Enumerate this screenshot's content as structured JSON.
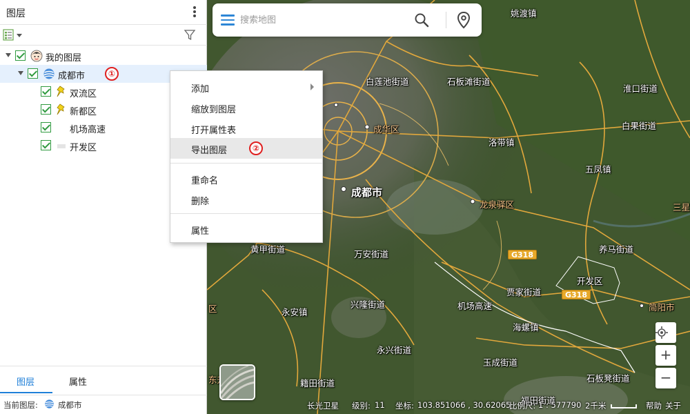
{
  "panel": {
    "title": "图层",
    "tree": {
      "root": {
        "label": "我的图层",
        "checked": true
      },
      "group": {
        "label": "成都市",
        "checked": true,
        "badge": "①"
      },
      "layers": [
        {
          "label": "双流区",
          "checked": true,
          "icon": "pushpin-icon"
        },
        {
          "label": "新都区",
          "checked": true,
          "icon": "pushpin-icon"
        },
        {
          "label": "机场高速",
          "checked": true,
          "icon": "none"
        },
        {
          "label": "开发区",
          "checked": true,
          "icon": "polygon-icon"
        }
      ]
    },
    "tabs": [
      {
        "label": "图层",
        "active": true
      },
      {
        "label": "属性",
        "active": false
      }
    ],
    "status": {
      "label": "当前图层:",
      "layer": "成都市"
    }
  },
  "context_menu": {
    "items": [
      {
        "label": "添加",
        "submenu": true
      },
      {
        "label": "缩放到图层"
      },
      {
        "label": "打开属性表"
      },
      {
        "label": "导出图层",
        "highlighted": true,
        "badge": "②"
      },
      {
        "label": "重命名"
      },
      {
        "label": "删除"
      },
      {
        "label": "属性"
      }
    ]
  },
  "search": {
    "placeholder": "搜索地图"
  },
  "map": {
    "places": [
      {
        "text": "姚渡镇"
      },
      {
        "text": "白莲池街道"
      },
      {
        "text": "石板滩街道"
      },
      {
        "text": "淮口街道"
      },
      {
        "text": "白果街道"
      },
      {
        "text": "成华区"
      },
      {
        "text": "洛带镇"
      },
      {
        "text": "五凤镇"
      },
      {
        "text": "成都市"
      },
      {
        "text": "龙泉驿区"
      },
      {
        "text": "三星"
      },
      {
        "text": "黄甲街道"
      },
      {
        "text": "万安街道"
      },
      {
        "text": "养马街道"
      },
      {
        "text": "开发区"
      },
      {
        "text": "贾家街道"
      },
      {
        "text": "机场高速"
      },
      {
        "text": "兴隆街道"
      },
      {
        "text": "永安镇"
      },
      {
        "text": "区"
      },
      {
        "text": "简阳市"
      },
      {
        "text": "海螺镇"
      },
      {
        "text": "永兴街道"
      },
      {
        "text": "玉成街道"
      },
      {
        "text": "籍田街道"
      },
      {
        "text": "石板凳街道"
      },
      {
        "text": "福田街道"
      },
      {
        "text": "东升"
      }
    ],
    "shields": [
      "G318",
      "G318"
    ],
    "status": {
      "source": "长光卫星",
      "level_label": "级别:",
      "level": "11",
      "coord_label": "坐标:",
      "coord": "103.851066 , 30.62065",
      "scale_label": "比例尺:",
      "scale": "1 : 577790",
      "scale_bar": "2千米",
      "help": "帮助",
      "extra": "关于"
    }
  },
  "colors": {
    "accent": "#1f7fd8",
    "checkbox": "#2f9a3f",
    "badge": "#e02020",
    "road": "#e7a92a",
    "selection": "#e5f0fd"
  }
}
